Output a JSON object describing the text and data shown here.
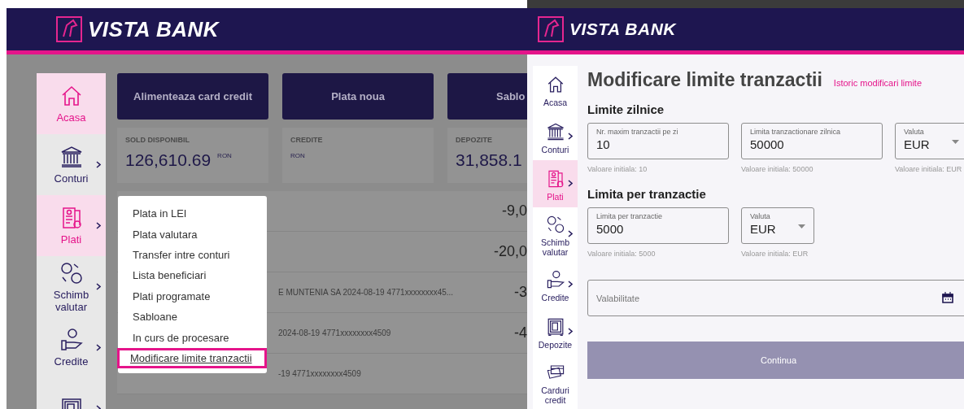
{
  "left_screen": {
    "logo": "VISTA BANK",
    "sidebar": [
      {
        "label": "Acasa",
        "selected": true,
        "submenu": false
      },
      {
        "label": "Conturi",
        "selected": false,
        "submenu": true
      },
      {
        "label": "Plati",
        "selected": true,
        "submenu": true
      },
      {
        "label": "Schimb valutar",
        "selected": false,
        "submenu": true
      },
      {
        "label": "Credite",
        "selected": false,
        "submenu": true
      },
      {
        "selected": false,
        "submenu": true
      }
    ],
    "actions": [
      "Alimenteaza card credit",
      "Plata noua",
      "Sablo"
    ],
    "balances": [
      {
        "label": "SOLD DISPONIBIL",
        "amount": "126,610.69",
        "currency": "RON"
      },
      {
        "label": "CREDITE",
        "currency": "RON"
      },
      {
        "label": "DEPOZITE",
        "amount": "31,858.1"
      }
    ],
    "transactions": [
      {
        "amount": "-9,0"
      },
      {
        "amount": "-20,0"
      },
      {
        "details": "E MUNTENIA SA 2024-08-19 4771xxxxxxxx45...",
        "amount": "-3"
      },
      {
        "details": "2024-08-19 4771xxxxxxxx4509",
        "amount": "-4"
      },
      {
        "details": "-19 4771xxxxxxxx4509"
      }
    ],
    "menu": [
      {
        "label": "Plata in LEI",
        "selected": false
      },
      {
        "label": "Plata valutara",
        "selected": false
      },
      {
        "label": "Transfer intre conturi",
        "selected": false
      },
      {
        "label": "Lista beneficiari",
        "selected": false
      },
      {
        "label": "Plati programate",
        "selected": false
      },
      {
        "label": "Sabloane",
        "selected": false
      },
      {
        "label": "In curs de procesare",
        "selected": false
      },
      {
        "label": "Modificare limite tranzactii",
        "selected": true
      }
    ]
  },
  "right_screen": {
    "logo": "VISTA BANK",
    "sidebar": [
      {
        "label": "Acasa",
        "selected": false,
        "submenu": false
      },
      {
        "label": "Conturi",
        "selected": false,
        "submenu": true
      },
      {
        "label": "Plati",
        "selected": true,
        "submenu": true
      },
      {
        "label": "Schimb valutar",
        "selected": false,
        "submenu": true
      },
      {
        "label": "Credite",
        "selected": false,
        "submenu": true
      },
      {
        "label": "Depozite",
        "selected": false,
        "submenu": true
      },
      {
        "label": "Carduri credit",
        "selected": false,
        "submenu": false
      }
    ],
    "title": "Modificare limite tranzactii",
    "history_link": "Istoric modificari limite",
    "sections": [
      {
        "heading": "Limite zilnice",
        "fields": [
          {
            "kind": "text",
            "label": "Nr. maxim tranzactii pe zi",
            "value": "10",
            "hint": "Valoare initiala: 10"
          },
          {
            "kind": "text",
            "label": "Limita tranzactionare zilnica",
            "value": "50000",
            "hint": "Valoare initiala: 50000"
          },
          {
            "kind": "select",
            "label": "Valuta",
            "value": "EUR",
            "hint": "Valoare initiala: EUR"
          }
        ]
      },
      {
        "heading": "Limita per tranzactie",
        "fields": [
          {
            "kind": "text",
            "label": "Limita per tranzactie",
            "value": "5000",
            "hint": "Valoare initiala: 5000"
          },
          {
            "kind": "select",
            "label": "Valuta",
            "value": "EUR",
            "hint": "Valoare initiala: EUR"
          }
        ]
      }
    ],
    "validity": {
      "placeholder": "Valabilitate"
    },
    "submit": {
      "label": "Continua",
      "disabled": true
    }
  }
}
